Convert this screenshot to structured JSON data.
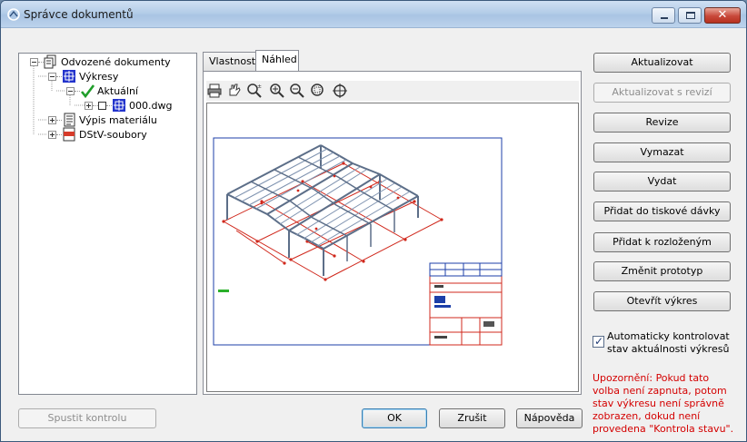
{
  "window": {
    "title": "Správce dokumentů"
  },
  "tree": {
    "items": [
      {
        "label": "Odvozené dokumenty"
      },
      {
        "label": "Výkresy"
      },
      {
        "label": "Aktuální"
      },
      {
        "label": "000.dwg"
      },
      {
        "label": "Výpis materiálu"
      },
      {
        "label": "DStV-soubory"
      }
    ]
  },
  "tabs": [
    {
      "label": "Vlastnosti"
    },
    {
      "label": "Náhled"
    }
  ],
  "buttons": {
    "aktualizovat": "Aktualizovat",
    "aktualizovat_revize": "Aktualizovat s revizí",
    "revize": "Revize",
    "vymazat": "Vymazat",
    "vydat": "Vydat",
    "pridat_tisk": "Přidat do tiskové dávky",
    "pridat_rozlozene": "Přidat k rozloženým",
    "zmenit_prototyp": "Změnit prototyp",
    "otevrit_vykres": "Otevřít výkres",
    "spustit_kontrolu": "Spustit kontrolu",
    "ok": "OK",
    "zrusit": "Zrušit",
    "napoveda": "Nápověda"
  },
  "auto_check": {
    "checked": true,
    "label": "Automaticky kontrolovat stav aktuálnosti výkresů"
  },
  "warning": "Upozornění: Pokud tato volba není zapnuta, potom stav výkresu není správně zobrazen, dokud není provedena \"Kontrola stavu\".",
  "colors": {
    "warning": "#d40000",
    "frame_blue": "#1c3fa8",
    "frame_red": "#d0281c"
  }
}
